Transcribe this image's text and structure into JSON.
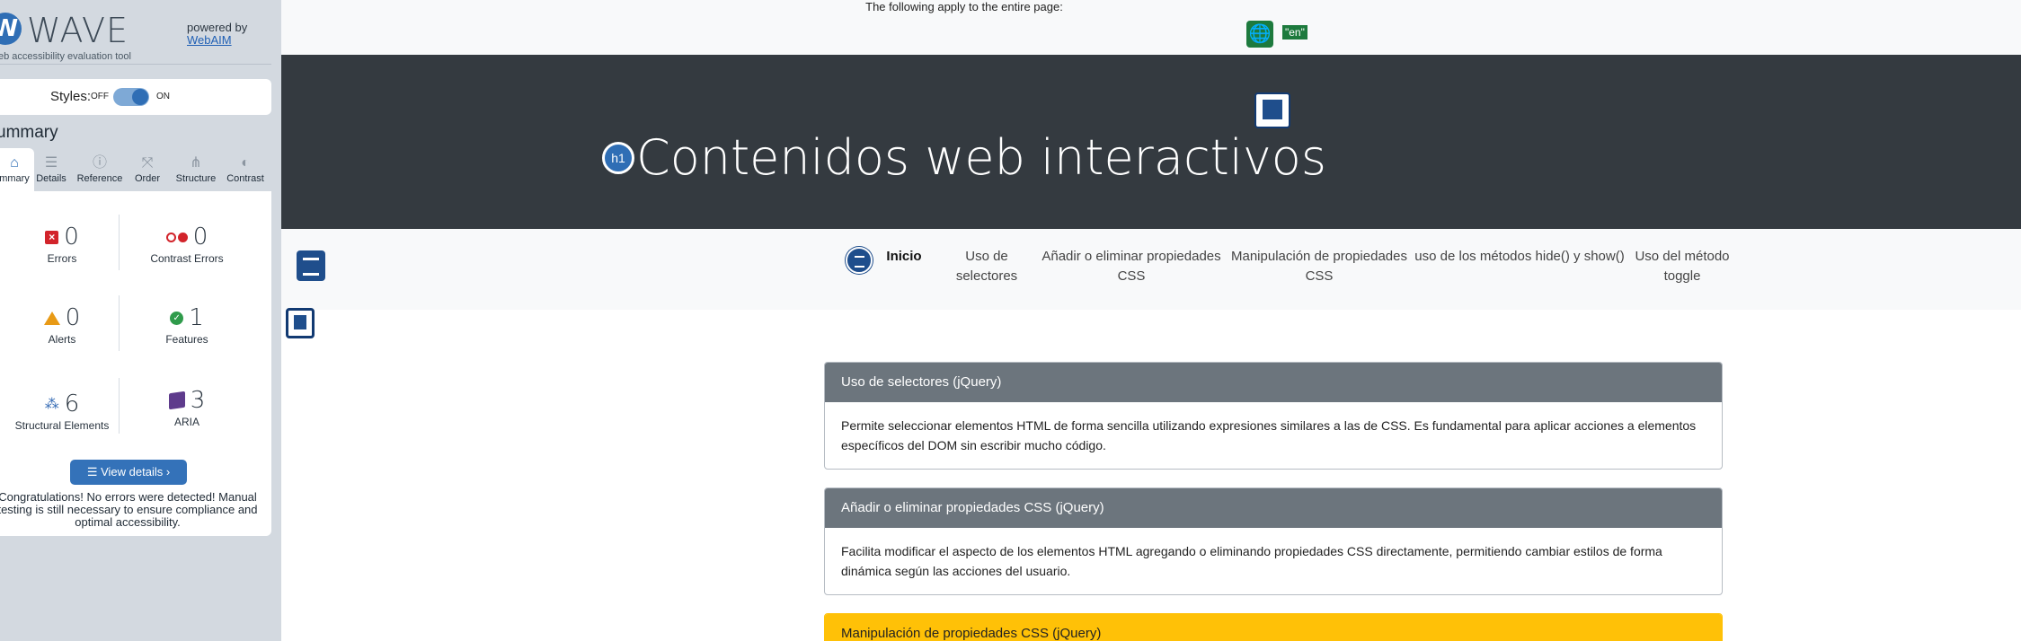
{
  "wave": {
    "logo_letter": "W",
    "logo_text": "WAVE",
    "tagline": "eb accessibility evaluation tool",
    "powered_by": "powered by",
    "webaim": "WebAIM",
    "styles_label": "Styles:",
    "styles_off": "OFF",
    "styles_on": "ON",
    "summary_title": "ummary",
    "tabs": [
      {
        "label": "mmary",
        "icon": "home-icon"
      },
      {
        "label": "Details",
        "icon": "list-icon"
      },
      {
        "label": "Reference",
        "icon": "info-icon"
      },
      {
        "label": "Order",
        "icon": "order-icon"
      },
      {
        "label": "Structure",
        "icon": "structure-icon"
      },
      {
        "label": "Contrast",
        "icon": "contrast-icon"
      }
    ],
    "stats": {
      "errors": {
        "value": "0",
        "label": "Errors"
      },
      "contrast_errors": {
        "value": "0",
        "label": "Contrast Errors"
      },
      "alerts": {
        "value": "0",
        "label": "Alerts"
      },
      "features": {
        "value": "1",
        "label": "Features"
      },
      "structural": {
        "value": "6",
        "label": "Structural Elements"
      },
      "aria": {
        "value": "3",
        "label": "ARIA"
      }
    },
    "view_details": "View details ›",
    "congrats": "Congratulations! No errors were detected! Manual testing is still necessary to ensure compliance and optimal accessibility."
  },
  "page": {
    "entire_text": "The following apply to the entire page:",
    "lang_badge": "\"en\"",
    "h1_badge": "h1",
    "title": "Contenidos web interactivos",
    "nav": [
      {
        "label": "Inicio"
      },
      {
        "label": "Uso de selectores"
      },
      {
        "label": "Añadir o eliminar propiedades CSS"
      },
      {
        "label": "Manipulación de propiedades CSS"
      },
      {
        "label": "uso de los métodos hide() y show()"
      },
      {
        "label": "Uso del método toggle"
      }
    ],
    "cards": [
      {
        "title": "Uso de selectores (jQuery)",
        "body": "Permite seleccionar elementos HTML de forma sencilla utilizando expresiones similares a las de CSS. Es fundamental para aplicar acciones a elementos específicos del DOM sin escribir mucho código."
      },
      {
        "title": "Añadir o eliminar propiedades CSS (jQuery)",
        "body": "Facilita modificar el aspecto de los elementos HTML agregando o eliminando propiedades CSS directamente, permitiendo cambiar estilos de forma dinámica según las acciones del usuario."
      },
      {
        "title": "Manipulación de propiedades CSS (jQuery)"
      }
    ]
  },
  "colors": {
    "wave_bg": "#d3d9e0",
    "wave_blue": "#2f6eb5",
    "hero_bg": "#343a40",
    "card_header": "#6c757d",
    "card_header_warning": "#ffc107",
    "wave_green": "#1d7a3d"
  }
}
